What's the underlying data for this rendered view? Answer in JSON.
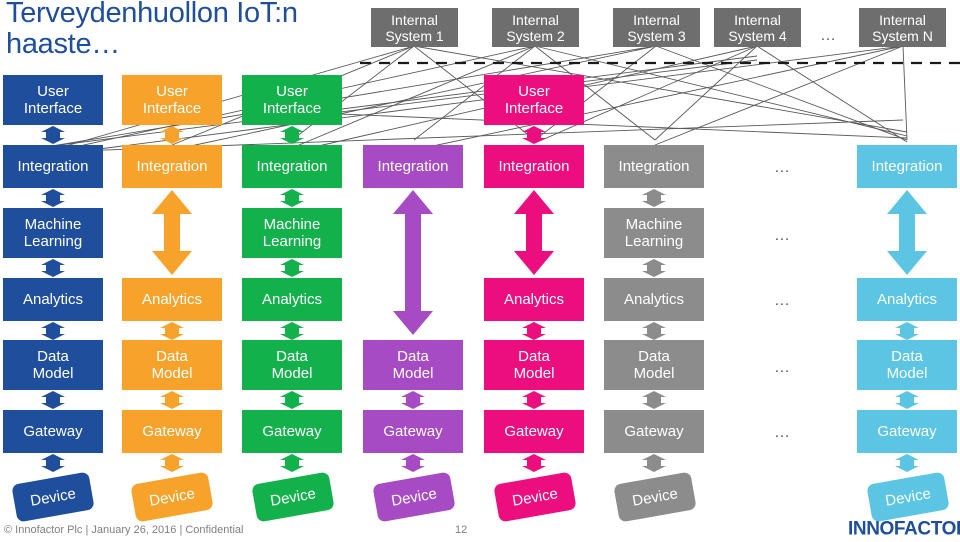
{
  "slide": {
    "title": "Terveydenhuollon\nIoT:n haaste…",
    "footer": "© Innofactor Plc | January 26, 2016 | Confidential",
    "page_number": "12",
    "logo": "INNOFACTOR",
    "logo_mark": "®"
  },
  "colors": {
    "blue": "#1F4E9C",
    "orange": "#F7A22B",
    "green": "#13B14B",
    "purple": "#A64BC4",
    "pink": "#EC0D7E",
    "gray": "#8C8C8C",
    "cyan": "#5BC5E3",
    "system_gray": "#6E6E6E",
    "title_blue": "#1F4E9C",
    "line_gray": "#595959",
    "footer_gray": "#7F7F7F"
  },
  "internal_systems": [
    {
      "label": "Internal\nSystem 1"
    },
    {
      "label": "Internal\nSystem 2"
    },
    {
      "label": "Internal\nSystem 3"
    },
    {
      "label": "Internal\nSystem 4"
    },
    {
      "label": "…"
    },
    {
      "label": "Internal\nSystem N"
    }
  ],
  "layer_names": {
    "user_interface": "User\nInterface",
    "integration": "Integration",
    "machine_learning": "Machine\nLearning",
    "analytics": "Analytics",
    "data_model": "Data\nModel",
    "gateway": "Gateway",
    "device": "Device"
  },
  "ellipsis_symbol": "…",
  "stacks": [
    {
      "name": "stack-1",
      "color": "#1F4E9C",
      "layers": [
        "User\nInterface",
        "Integration",
        "Machine\nLearning",
        "Analytics",
        "Data\nModel",
        "Gateway",
        "Device"
      ]
    },
    {
      "name": "stack-2",
      "color": "#F7A22B",
      "layers": [
        "User\nInterface",
        "Integration",
        "Analytics",
        "Data\nModel",
        "Gateway",
        "Device"
      ]
    },
    {
      "name": "stack-3",
      "color": "#13B14B",
      "layers": [
        "User\nInterface",
        "Integration",
        "Machine\nLearning",
        "Analytics",
        "Data\nModel",
        "Gateway",
        "Device"
      ]
    },
    {
      "name": "stack-4",
      "color": "#A64BC4",
      "layers": [
        "Integration",
        "Data\nModel",
        "Gateway",
        "Device"
      ]
    },
    {
      "name": "stack-5",
      "color": "#EC0D7E",
      "layers": [
        "User\nInterface",
        "Integration",
        "Analytics",
        "Data\nModel",
        "Gateway",
        "Device"
      ]
    },
    {
      "name": "stack-6",
      "color": "#8C8C8C",
      "layers": [
        "Integration",
        "Machine\nLearning",
        "Analytics",
        "Data\nModel",
        "Gateway",
        "Device"
      ]
    },
    {
      "name": "stack-n",
      "color": "#5BC5E3",
      "layers": [
        "Integration",
        "Analytics",
        "Data\nModel",
        "Gateway",
        "Device"
      ]
    }
  ]
}
